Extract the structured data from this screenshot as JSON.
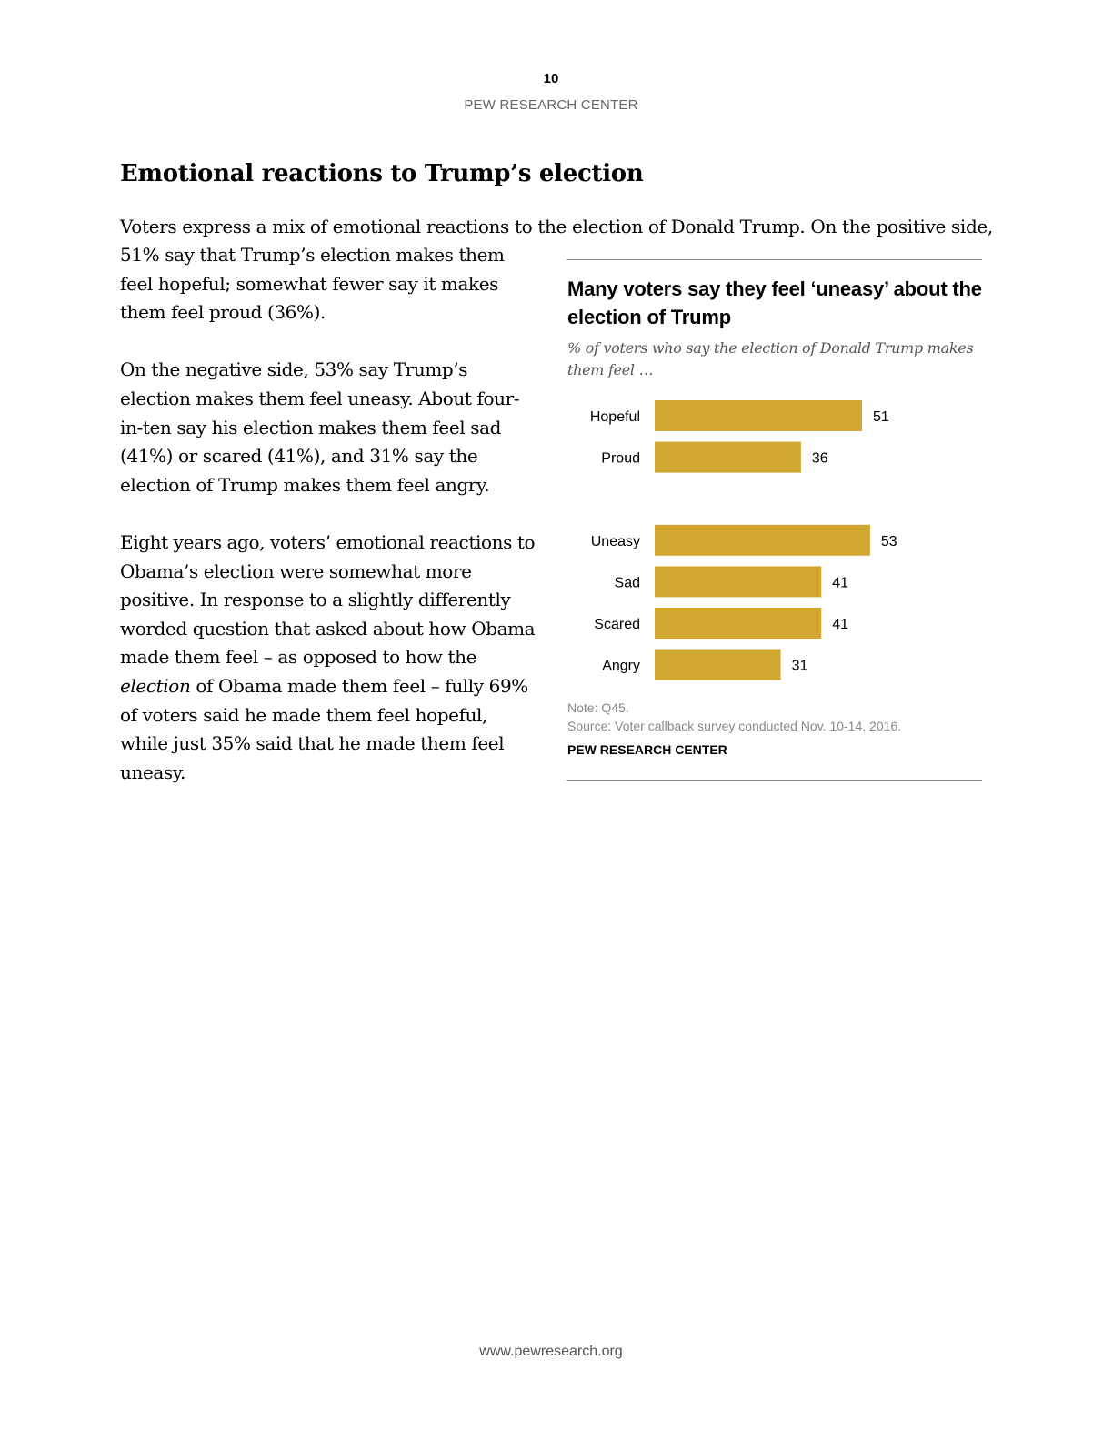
{
  "header": {
    "page_number": "10",
    "org": "PEW RESEARCH CENTER"
  },
  "article": {
    "title": "Emotional reactions to Trump’s election",
    "intro_line": "Voters express a mix of emotional reactions to the election of Donald Trump. On the positive side,",
    "paragraphs": [
      "51% say that Trump’s election makes them feel hopeful; somewhat fewer say it makes them feel proud (36%).",
      "On the negative side, 53% say Trump’s election makes them feel uneasy. About four-in-ten say his election makes them feel sad (41%) or scared (41%), and 31% say the election of Trump makes them feel angry."
    ],
    "p3_before_em": "Eight years ago, voters’ emotional reactions to Obama’s election were somewhat more positive. In response to a slightly differently worded question that asked about how Obama made them feel – as opposed to how the ",
    "p3_em": "election",
    "p3_after_em": " of Obama made them feel – fully 69% of voters said he made them feel hopeful, while just 35% said that he made them feel uneasy."
  },
  "chart_data": {
    "type": "bar",
    "orientation": "horizontal",
    "title": "Many voters say they feel ‘uneasy’ about the election of Trump",
    "subtitle": "% of voters who say the election of Donald Trump makes them feel …",
    "categories": [
      "Hopeful",
      "Proud",
      "Uneasy",
      "Sad",
      "Scared",
      "Angry"
    ],
    "values": [
      51,
      36,
      53,
      41,
      41,
      31
    ],
    "groups": [
      [
        "Hopeful",
        "Proud"
      ],
      [
        "Uneasy",
        "Sad",
        "Scared",
        "Angry"
      ]
    ],
    "xlabel": "",
    "ylabel": "",
    "xlim": [
      0,
      100
    ],
    "grid": false,
    "legend": "none",
    "bar_color": "#D3A832",
    "note": "Note: Q45.",
    "source": "Source: Voter callback survey conducted Nov. 10-14, 2016.",
    "credit": "PEW RESEARCH CENTER"
  },
  "footer": {
    "url": "www.pewresearch.org"
  }
}
